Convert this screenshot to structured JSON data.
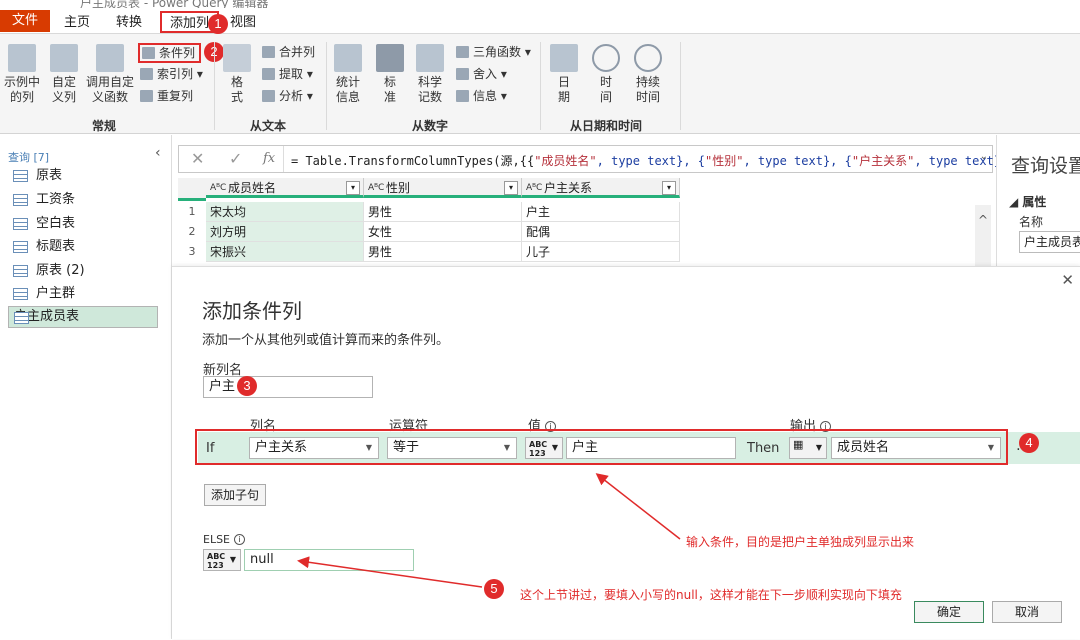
{
  "window": {
    "title": "户主成员表 - Power Query 编辑器"
  },
  "menu": {
    "file": "文件",
    "home": "主页",
    "transform": "转换",
    "add_column": "添加列",
    "view": "视图"
  },
  "ribbon": {
    "example_col": [
      "示例中",
      "的列"
    ],
    "custom_col": [
      "自定",
      "义列"
    ],
    "invoke_fn": [
      "调用自定",
      "义函数"
    ],
    "conditional_col": "条件列",
    "index_col": "索引列",
    "duplicate_col": "重复列",
    "group_general": "常规",
    "format": [
      "格",
      "式"
    ],
    "merge_cols": "合并列",
    "extract": "提取",
    "parse": "分析",
    "group_text": "从文本",
    "statistics": [
      "统计",
      "信息"
    ],
    "standard": [
      "标",
      "准"
    ],
    "scientific": [
      "科学",
      "记数"
    ],
    "trig": "三角函数",
    "rounding": "舍入",
    "information": "信息",
    "group_number": "从数字",
    "date": [
      "日",
      "期"
    ],
    "time": [
      "时",
      "间"
    ],
    "duration": [
      "持续",
      "时间"
    ],
    "group_datetime": "从日期和时间"
  },
  "queries": {
    "header": "查询 [7]",
    "items": [
      "原表",
      "工资条",
      "空白表",
      "标题表",
      "原表 (2)",
      "户主群",
      "户主成员表"
    ]
  },
  "formula": {
    "prefix": "= Table.TransformColumnTypes(源,{{",
    "s1": "\"成员姓名\"",
    "t1": ", type text}, {",
    "s2": "\"性别\"",
    "t2": ", type text}, {",
    "s3": "\"户主关系\"",
    "t3": ", type text}})"
  },
  "grid": {
    "columns": [
      "成员姓名",
      "性别",
      "户主关系"
    ],
    "rows": [
      [
        "宋太均",
        "男性",
        "户主"
      ],
      [
        "刘方明",
        "女性",
        "配偶"
      ],
      [
        "宋振兴",
        "男性",
        "儿子"
      ]
    ]
  },
  "right_pane": {
    "title": "查询设置",
    "properties": "属性",
    "name_label": "名称",
    "name_value": "户主成员表"
  },
  "dialog": {
    "title": "添加条件列",
    "subtitle": "添加一个从其他列或值计算而来的条件列。",
    "new_col_label": "新列名",
    "new_col_value": "户主",
    "hdr_col": "列名",
    "hdr_op": "运算符",
    "hdr_val": "值",
    "hdr_out": "输出",
    "if": "If",
    "col_value": "户主关系",
    "op_value": "等于",
    "val_value": "户主",
    "then": "Then",
    "out_value": "成员姓名",
    "add_clause": "添加子句",
    "else_label": "ELSE",
    "else_value": "null",
    "ok": "确定",
    "cancel": "取消"
  },
  "annotations": {
    "note1": "输入条件，目的是把户主单独成列显示出来",
    "note2": "这个上节讲过，要填入小写的null，这样才能在下一步顺利实现向下填充",
    "badges": [
      "1",
      "2",
      "3",
      "4",
      "5"
    ]
  },
  "colors": {
    "file_tab": "#d83b01",
    "annot_red": "#e02b2b",
    "row_green": "#d8efe3",
    "selected": "#cfe8da"
  }
}
